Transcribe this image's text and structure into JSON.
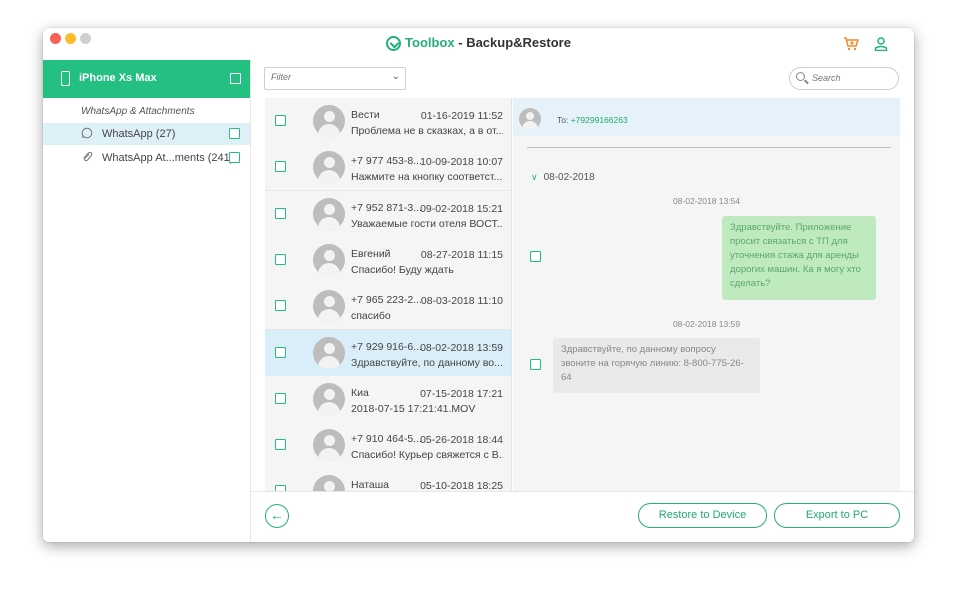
{
  "app": {
    "brand": "Toolbox",
    "title_rest": " - Backup&Restore"
  },
  "icons": {
    "logo": "toolbox-logo-icon",
    "cart": "cart-icon",
    "user": "user-icon",
    "phone": "phone-icon",
    "whatsapp": "whatsapp-icon",
    "attachment": "paperclip-icon",
    "search": "search-icon",
    "back": "back-arrow-icon"
  },
  "colors": {
    "accent": "#23c081",
    "cart": "#f08a2a",
    "selected_row": "#d9eef8",
    "outgoing_bubble": "#bfeac0",
    "incoming_bubble": "#e9e9e9"
  },
  "sidebar": {
    "device_name": "iPhone Xs Max",
    "section_label": "WhatsApp & Attachments",
    "items": [
      {
        "label": "WhatsApp (27)",
        "selected": true
      },
      {
        "label": "WhatsApp At...ments (241)",
        "selected": false
      }
    ]
  },
  "toolbar": {
    "filter_placeholder": "Filter",
    "search_placeholder": "Search"
  },
  "conversations": [
    {
      "name": "Вести",
      "date": "01-16-2019 11:52",
      "preview": "Проблема не в сказках, а в от..."
    },
    {
      "name": "+7 977 453-8...",
      "date": "10-09-2018 10:07",
      "preview": "Нажмите на кнопку соответст..."
    },
    {
      "name": "+7 952 871-3...",
      "date": "09-02-2018 15:21",
      "preview": "Уважаемые гости отеля ВОСТ..."
    },
    {
      "name": "Евгений",
      "date": "08-27-2018 11:15",
      "preview": "Спасибо! Буду ждать"
    },
    {
      "name": "+7 965 223-2...",
      "date": "08-03-2018 11:10",
      "preview": "спасибо"
    },
    {
      "name": "+7 929 916-6...",
      "date": "08-02-2018 13:59",
      "preview": "Здравствуйте, по данному во...",
      "selected": true
    },
    {
      "name": "Киа",
      "date": "07-15-2018 17:21",
      "preview": "2018-07-15 17:21:41.MOV"
    },
    {
      "name": "+7 910 464-5...",
      "date": "05-26-2018 18:44",
      "preview": "Спасибо! Курьер свяжется с В..."
    },
    {
      "name": "Наташа",
      "date": "05-10-2018 18:25",
      "preview": ""
    }
  ],
  "detail": {
    "to_label": "To:",
    "to_number": "+79299166263",
    "date_group": "08-02-2018",
    "messages": [
      {
        "time": "08-02-2018 13:54",
        "direction": "out",
        "text": "Здравствуйте.  Приложение просит связаться с ТП для уточнения стажа для аренды дорогих машин. Ка я могу хто сделать?"
      },
      {
        "time": "08-02-2018 13:59",
        "direction": "in",
        "text": "Здравствуйте, по данному вопросу звоните на горячую линию: 8-800-775-26-64"
      }
    ]
  },
  "footer": {
    "restore_label": "Restore to Device",
    "export_label": "Export to PC"
  }
}
